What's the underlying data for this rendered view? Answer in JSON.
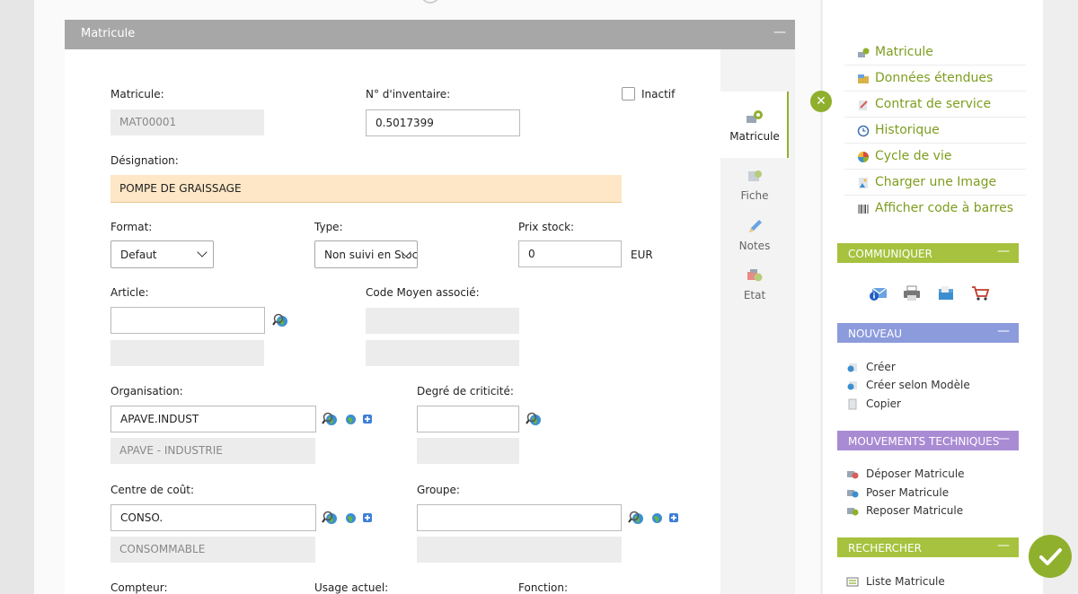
{
  "section": {
    "title": "Matricule",
    "collapse": "—"
  },
  "form": {
    "matricule_label": "Matricule:",
    "matricule_value": "MAT00001",
    "inventaire_label": "N° d'inventaire:",
    "inventaire_value": "0.5017399",
    "inactif_label": "Inactif",
    "designation_label": "Désignation:",
    "designation_value": "POMPE DE GRAISSAGE",
    "format_label": "Format:",
    "format_value": "Defaut",
    "type_label": "Type:",
    "type_value": "Non suivi en Stock",
    "prix_label": "Prix stock:",
    "prix_value": "0",
    "prix_unit": "EUR",
    "article_label": "Article:",
    "article_value": "",
    "code_moyen_label": "Code Moyen associé:",
    "organisation_label": "Organisation:",
    "organisation_value": "APAVE.INDUST",
    "organisation_desc": "APAVE - INDUSTRIE",
    "criticite_label": "Degré de criticité:",
    "criticite_value": "",
    "centre_label": "Centre de coût:",
    "centre_value": "CONSO.",
    "centre_desc": "CONSOMMABLE",
    "groupe_label": "Groupe:",
    "groupe_value": "",
    "compteur_label": "Compteur:",
    "usage_label": "Usage actuel:",
    "fonction_label": "Fonction:"
  },
  "tabs": [
    {
      "label": "Matricule",
      "icon": "gear-icon"
    },
    {
      "label": "Fiche",
      "icon": "fiche-icon"
    },
    {
      "label": "Notes",
      "icon": "pencil-icon"
    },
    {
      "label": "Etat",
      "icon": "etat-icon"
    }
  ],
  "sidebar": {
    "links": [
      {
        "label": "Matricule",
        "icon": "gear-icon"
      },
      {
        "label": "Données étendues",
        "icon": "data-icon"
      },
      {
        "label": "Contrat de service",
        "icon": "contract-icon"
      },
      {
        "label": "Historique",
        "icon": "history-icon"
      },
      {
        "label": "Cycle de vie",
        "icon": "cycle-icon"
      },
      {
        "label": "Charger une Image",
        "icon": "image-icon"
      },
      {
        "label": "Afficher code à barres",
        "icon": "barcode-icon"
      }
    ],
    "communiquer": {
      "title": "COMMUNIQUER",
      "icons": [
        "mail-info-icon",
        "print-icon",
        "folder-icon",
        "cart-icon"
      ]
    },
    "nouveau": {
      "title": "NOUVEAU",
      "items": [
        "Créer",
        "Créer selon Modèle",
        "Copier"
      ]
    },
    "mouvements": {
      "title": "MOUVEMENTS TECHNIQUES",
      "items": [
        "Déposer Matricule",
        "Poser Matricule",
        "Reposer Matricule"
      ]
    },
    "rechercher": {
      "title": "RECHERCHER",
      "items": [
        "Liste Matricule"
      ]
    },
    "collapse": "—"
  },
  "colors": {
    "accent": "#8fb02d",
    "link": "#7e9d1e",
    "highlight": "#fde7c6"
  }
}
